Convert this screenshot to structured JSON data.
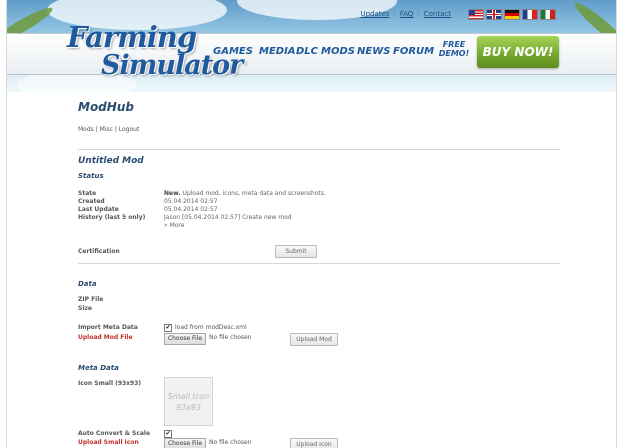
{
  "header": {
    "top_links": [
      "Updates",
      "FAQ",
      "Contact"
    ],
    "logo_line1": "Farming",
    "logo_line2": "Simulator",
    "nav": [
      "GAMES",
      "MEDIA",
      "DLC",
      "MODS",
      "NEWS",
      "FORUM"
    ],
    "demo_line1": "FREE",
    "demo_line2": "DEMO!",
    "buy_now": "BUY NOW!",
    "flags": [
      "us-flag",
      "uk-flag",
      "de-flag",
      "fr-flag",
      "it-flag"
    ]
  },
  "page": {
    "title": "ModHub",
    "submenu": [
      "Mods",
      "Misc",
      "Logout"
    ]
  },
  "mod": {
    "name": "Untitled Mod",
    "status_heading": "Status",
    "state_label": "State",
    "state_value_bold": "New.",
    "state_value_rest": " Upload mod, icons, meta data and screenshots.",
    "created_label": "Created",
    "created_value": "05.04.2014 02:57",
    "last_update_label": "Last Update",
    "last_update_value": "05.04.2014 02:57",
    "history_label": "History (last 5 only)",
    "history_value": "Jason [05.04.2014 02:57] Create new mod",
    "more_link": "» More",
    "certification_label": "Certification",
    "submit_button": "Submit"
  },
  "data_section": {
    "heading": "Data",
    "zip_label": "ZIP File",
    "size_label": "Size",
    "import_label": "Import Meta Data",
    "import_checkbox_label": "load from modDesc.xml",
    "import_checked": true,
    "upload_label": "Upload Mod File",
    "choose_file": "Choose File",
    "no_file": "No file chosen",
    "upload_button": "Upload Mod"
  },
  "meta_section": {
    "heading": "Meta Data",
    "icon_label": "Icon Small (93x93)",
    "icon_placeholder_line1": "Small Icon",
    "icon_placeholder_line2": "93x93",
    "auto_convert_label": "Auto Convert & Scale",
    "auto_convert_checked": true,
    "upload_icon_label": "Upload Small Icon",
    "choose_file": "Choose File",
    "no_file": "No file chosen",
    "upload_icon_button": "Upload Icon"
  },
  "colors": {
    "brand_blue": "#1e5a9c",
    "buy_green": "#74a72d",
    "required_red": "#c0312b",
    "heading_blue": "#2b4d6e"
  }
}
